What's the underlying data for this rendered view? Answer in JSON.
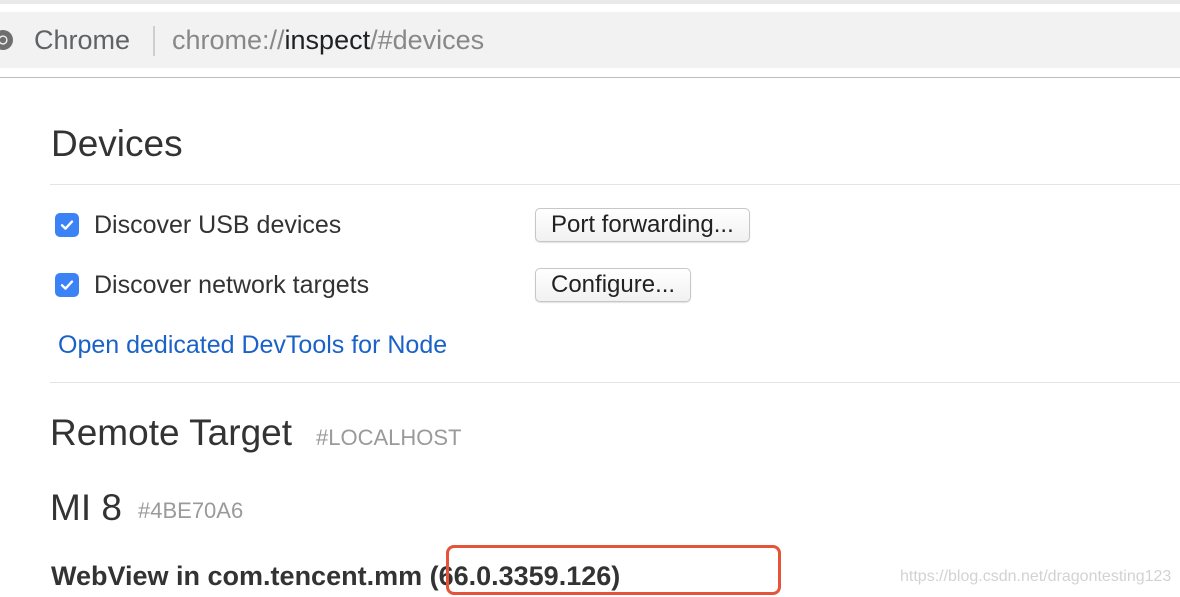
{
  "browser": {
    "app_name": "Chrome",
    "url_scheme": "chrome://",
    "url_host": "inspect",
    "url_path": "/#devices"
  },
  "devices": {
    "title": "Devices",
    "discover_usb": {
      "label": "Discover USB devices",
      "checked": true,
      "button_label": "Port forwarding..."
    },
    "discover_network": {
      "label": "Discover network targets",
      "checked": true,
      "button_label": "Configure..."
    },
    "node_link": "Open dedicated DevTools for Node"
  },
  "remote_target": {
    "title": "Remote Target",
    "subtitle": "#LOCALHOST",
    "device": {
      "name": "MI 8",
      "serial": "#4BE70A6",
      "browser": "WebView in com.tencent.mm (66.0.3359.126)"
    }
  },
  "annotation": {
    "highlight_color": "#e5533a"
  },
  "watermark": "https://blog.csdn.net/dragontesting123",
  "colors": {
    "checkbox": "#3b82f6",
    "link": "#1a62c8"
  }
}
